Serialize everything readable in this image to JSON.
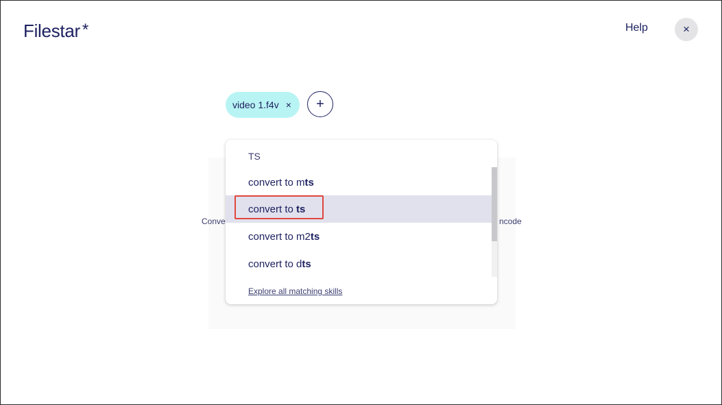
{
  "app": {
    "logo_text": "Filestar",
    "logo_mark": "*"
  },
  "header": {
    "help_label": "Help",
    "close_label": "×"
  },
  "files": [
    {
      "name": "video 1.f4v",
      "remove_label": "×"
    }
  ],
  "add_button_label": "+",
  "background": {
    "left_fragment": "Conve",
    "right_fragment": "ncode"
  },
  "dropdown": {
    "header": "TS",
    "items": [
      {
        "prefix": "convert to m",
        "match": "ts",
        "selected": false
      },
      {
        "prefix": "convert to ",
        "match": "ts",
        "selected": true
      },
      {
        "prefix": "convert to m2",
        "match": "ts",
        "selected": false
      },
      {
        "prefix": "convert to d",
        "match": "ts",
        "selected": false
      }
    ],
    "explore_label": "Explore all matching skills"
  },
  "colors": {
    "brand_navy": "#1e2260",
    "chip_bg": "#b9f4f4",
    "selected_bg": "#e1e1ed",
    "highlight_border": "#e0463c"
  }
}
